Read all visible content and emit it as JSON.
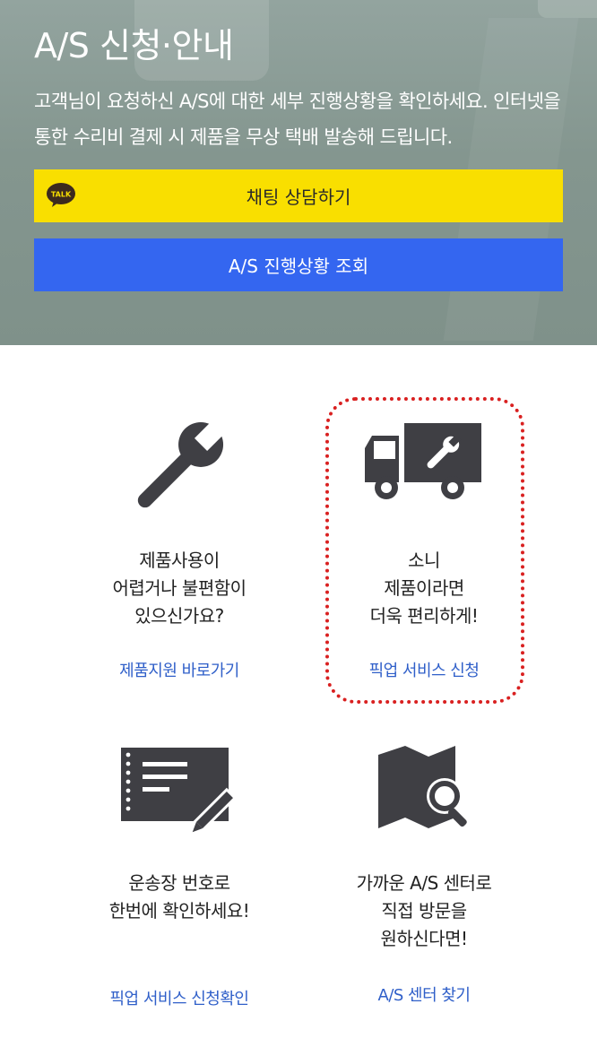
{
  "header": {
    "title": "A/S 신청·안내",
    "description": "고객님이 요청하신 A/S에 대한 세부 진행상황을 확인하세요. 인터넷을 통한 수리비 결제 시 제품을 무상 택배 발송해 드립니다."
  },
  "buttons": {
    "chat_label": "채팅 상담하기",
    "chat_badge": "TALK",
    "status_label": "A/S 진행상황 조회"
  },
  "cards": [
    {
      "icon": "wrench-icon",
      "text": "제품사용이\n어렵거나 불편함이\n있으신가요?",
      "link": "제품지원 바로가기"
    },
    {
      "icon": "truck-icon",
      "text": "소니\n제품이라면\n더욱 편리하게!",
      "link": "픽업 서비스 신청"
    },
    {
      "icon": "document-pen-icon",
      "text": "운송장 번호로\n한번에 확인하세요!",
      "link": "픽업 서비스 신청확인"
    },
    {
      "icon": "map-search-icon",
      "text": "가까운 A/S 센터로\n직접 방문을\n원하신다면!",
      "link": "A/S 센터 찾기"
    }
  ],
  "colors": {
    "chat_button": "#f9df00",
    "status_button": "#3466f0",
    "link": "#2f5fc9",
    "highlight": "#d92020",
    "icon": "#3f3f44"
  }
}
